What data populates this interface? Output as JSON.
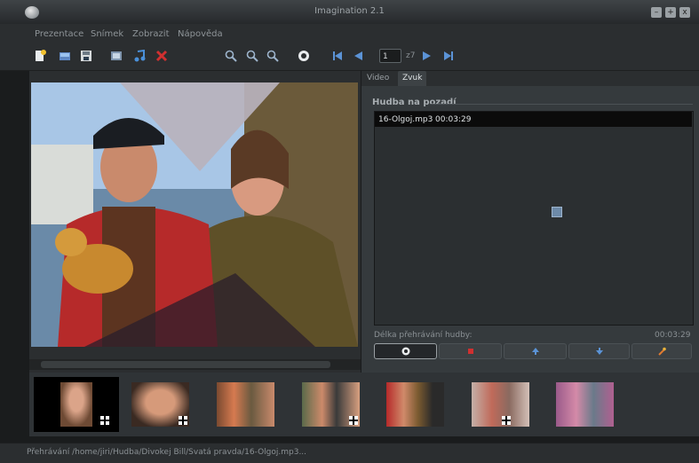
{
  "window": {
    "title": "Imagination 2.1",
    "minimize": "–",
    "maximize": "+",
    "close": "x"
  },
  "menu": [
    "Prezentace",
    "Snímek",
    "Zobrazit",
    "Nápověda"
  ],
  "toolbar": {
    "slide_number": "1",
    "slide_total": "z7",
    "icons": [
      "new-document-icon",
      "import-picture-icon",
      "save-icon",
      "import-image-icon",
      "import-audio-icon",
      "delete-icon",
      "zoom-in-icon",
      "zoom-out-icon",
      "zoom-fit-icon",
      "preview-icon",
      "first-slide-icon",
      "prev-slide-icon",
      "next-slide-icon",
      "last-slide-icon"
    ]
  },
  "tabs": [
    "Video",
    "Zvuk"
  ],
  "panel": {
    "section_title": "Hudba na pozadí",
    "music_files": [
      {
        "name": "16-Olgoj.mp3",
        "duration": "00:03:29"
      }
    ],
    "length_label": "Délka přehrávání hudby:",
    "length_value": "00:03:29",
    "buttons": [
      "add-audio-button",
      "remove-audio-button",
      "move-up-button",
      "move-down-button",
      "clear-button"
    ]
  },
  "filmstrip": {
    "count": 7,
    "selected_index": 0
  },
  "status": {
    "text": "Přehrávání /home/jiri/Hudba/Divokej Bill/Svatá pravda/16-Olgoj.mp3..."
  },
  "colors": {
    "background": "#1a1c1d",
    "panel": "#2b2e30",
    "list_bg": "#2b2f31",
    "accent": "#4a90d9",
    "delete_red": "#d03030"
  }
}
